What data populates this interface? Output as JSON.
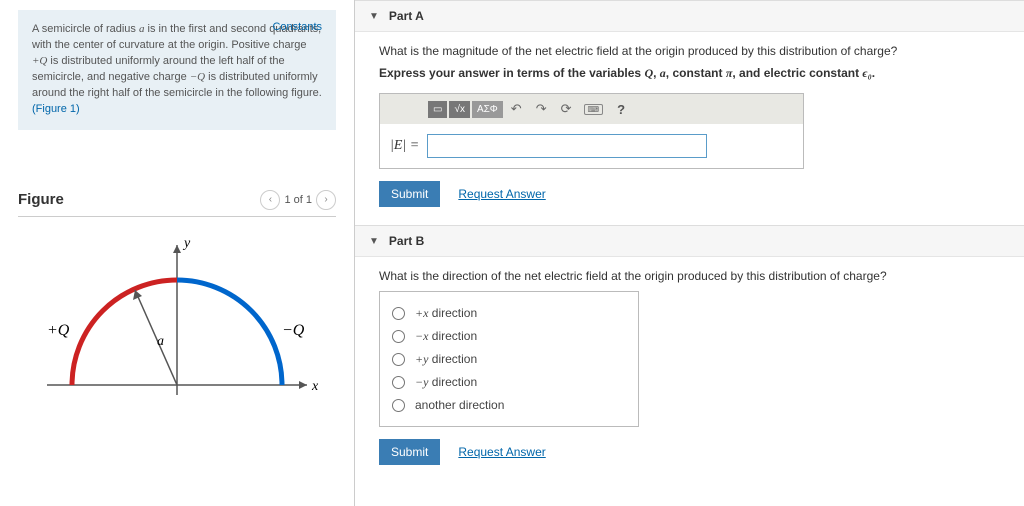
{
  "left": {
    "constants_link": "Constants",
    "problem_text_1": "A semicircle of radius ",
    "problem_var_a": "a",
    "problem_text_2": " is in the first and second quadrants, with the center of curvature at the origin. Positive charge ",
    "problem_var_Qp": "+Q",
    "problem_text_3": " is distributed uniformly around the left half of the semicircle, and negative charge ",
    "problem_var_Qn": "−Q",
    "problem_text_4": " is distributed uniformly around the right half of the semicircle in the following figure.",
    "figure_link": "(Figure 1)"
  },
  "figure": {
    "title": "Figure",
    "page": "1 of 1",
    "label_y": "y",
    "label_x": "x",
    "label_a": "a",
    "label_Qp": "+Q",
    "label_Qn": "−Q"
  },
  "partA": {
    "title": "Part A",
    "question": "What is the magnitude of the net electric field at the origin produced by this distribution of charge?",
    "instruction_1": "Express your answer in terms of the variables ",
    "instr_Q": "Q",
    "instr_comma1": ", ",
    "instr_a": "a",
    "instr_comma2": ", constant ",
    "instr_pi": "π",
    "instr_comma3": ", and electric constant ",
    "instr_e0": "ϵ₀",
    "instr_period": ".",
    "tool_sqrt": "√x",
    "tool_asf": "ΑΣΦ",
    "answer_label": "|E| =",
    "submit": "Submit",
    "request": "Request Answer"
  },
  "partB": {
    "title": "Part B",
    "question": "What is the direction of the net electric field at the origin produced by this distribution of charge?",
    "options": [
      "+x direction",
      "−x direction",
      "+y direction",
      "−y direction",
      "another direction"
    ],
    "submit": "Submit",
    "request": "Request Answer"
  }
}
